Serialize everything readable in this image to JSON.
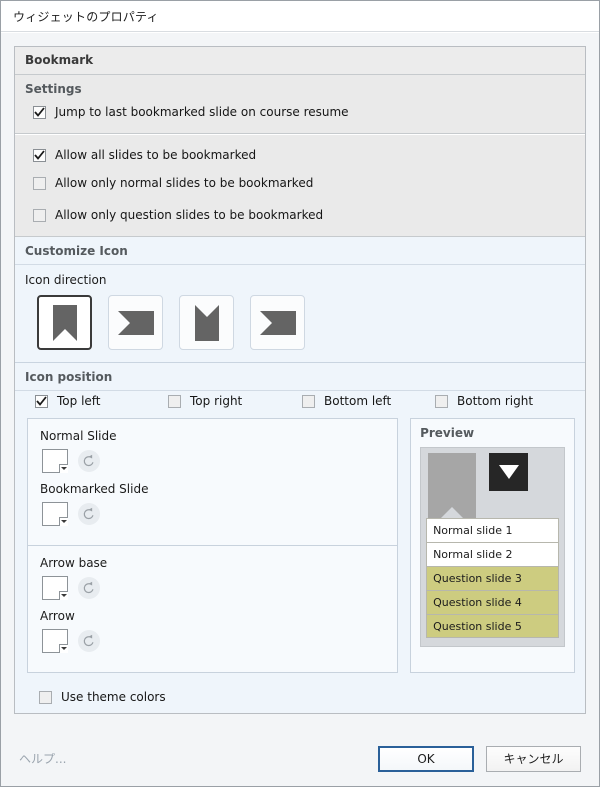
{
  "window": {
    "title": "ウィジェットのプロパティ"
  },
  "panel": {
    "header": "Bookmark"
  },
  "settings": {
    "group_label": "Settings",
    "jump_option": {
      "label": "Jump to last bookmarked slide on course resume",
      "checked": true
    }
  },
  "allow": {
    "options": [
      {
        "label": "Allow all slides to be bookmarked",
        "checked": true
      },
      {
        "label": "Allow only normal slides to be bookmarked",
        "checked": false
      },
      {
        "label": "Allow only question slides to be bookmarked",
        "checked": false
      }
    ]
  },
  "customize_icon": {
    "group_label": "Customize Icon",
    "direction_label": "Icon direction",
    "directions": [
      {
        "name": "bookmark-down",
        "selected": true
      },
      {
        "name": "bookmark-left",
        "selected": false
      },
      {
        "name": "bookmark-up",
        "selected": false
      },
      {
        "name": "bookmark-right",
        "selected": false
      }
    ]
  },
  "icon_position": {
    "group_label": "Icon position",
    "options": [
      {
        "label": "Top left",
        "checked": true
      },
      {
        "label": "Top right",
        "checked": false
      },
      {
        "label": "Bottom left",
        "checked": false
      },
      {
        "label": "Bottom right",
        "checked": false
      }
    ]
  },
  "colors": {
    "normal_slide": {
      "label": "Normal Slide",
      "value": "#8c8c8c",
      "reset_icon": "reset-icon"
    },
    "bookmarked_slide": {
      "label": "Bookmarked Slide",
      "value": "#2ecc0f",
      "reset_icon": "reset-icon"
    },
    "arrow_base": {
      "label": "Arrow base",
      "value": "#262626",
      "reset_icon": "reset-icon"
    },
    "arrow": {
      "label": "Arrow",
      "value": "#ffffff",
      "reset_icon": "reset-icon"
    }
  },
  "preview": {
    "title": "Preview",
    "canvas_bg": "#d5d8dc",
    "bookmark_color": "#a6a6a6",
    "arrow_base_color": "#262626",
    "arrow_color": "#ffffff",
    "slides": [
      {
        "label": "Normal slide 1",
        "color": "#ffffff"
      },
      {
        "label": "Normal slide 2",
        "color": "#ffffff"
      },
      {
        "label": "Question slide 3",
        "color": "#cdcc80"
      },
      {
        "label": "Question slide 4",
        "color": "#cdcc80"
      },
      {
        "label": "Question slide 5",
        "color": "#cdcc80"
      }
    ]
  },
  "theme": {
    "use_theme_colors": {
      "label": "Use theme colors",
      "checked": false
    }
  },
  "footer": {
    "help_label": "ヘルプ...",
    "ok_label": "OK",
    "cancel_label": "キャンセル",
    "focus_color": "#2a6099"
  }
}
